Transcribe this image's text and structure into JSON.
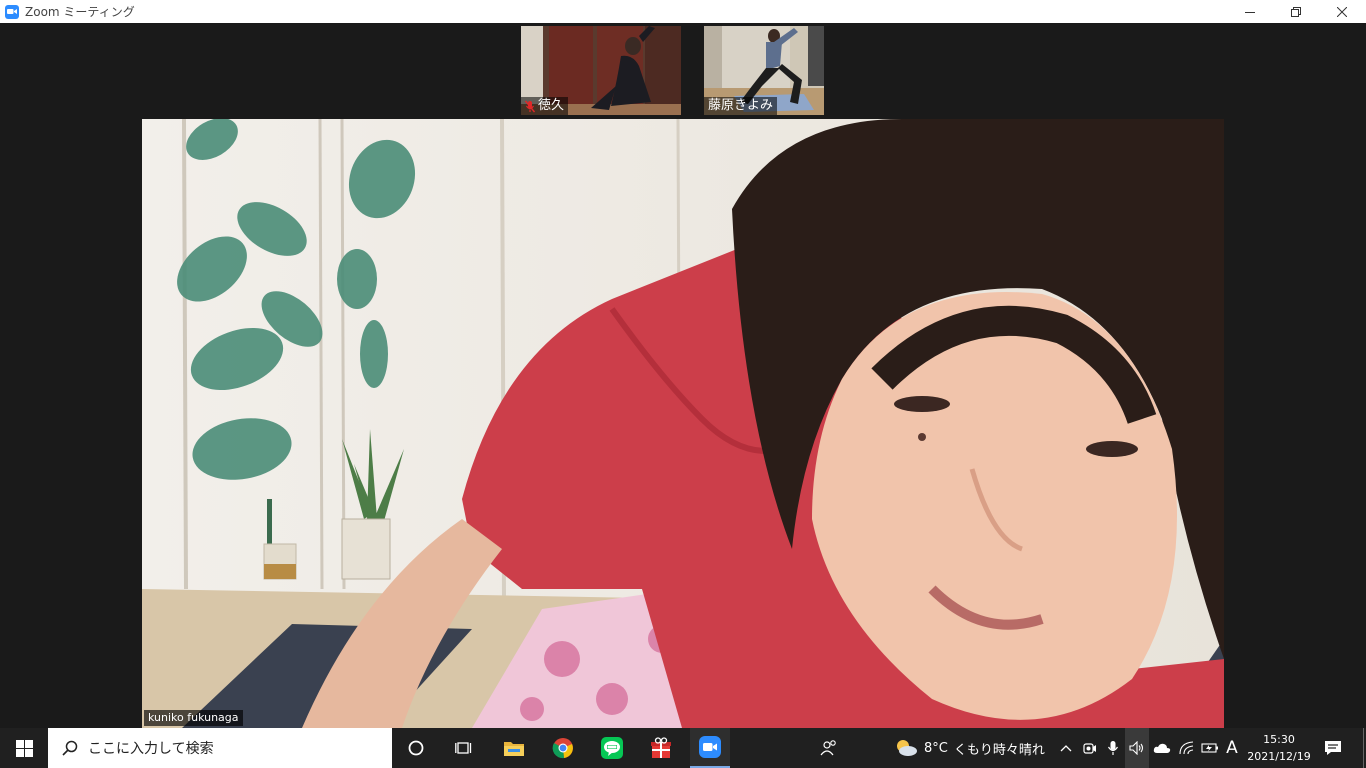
{
  "window": {
    "title": "Zoom ミーティング",
    "minimize_label": "—",
    "restore_label": "❐",
    "close_label": "✕"
  },
  "participants": {
    "thumbnails": [
      {
        "name": "徳久",
        "muted": true
      },
      {
        "name": "藤原きよみ",
        "muted": false
      }
    ],
    "speaker": {
      "name": "kuniko fukunaga"
    }
  },
  "taskbar": {
    "search_placeholder": "ここに入力して検索",
    "pinned_apps": [
      "cortana-icon",
      "task-view-icon",
      "file-explorer-icon",
      "chrome-icon",
      "line-icon",
      "gift-app-icon",
      "zoom-icon"
    ],
    "weather": {
      "temp": "8°C",
      "condition": "くもり時々晴れ"
    },
    "ime": "A",
    "clock": {
      "time": "15:30",
      "date": "2021/12/19"
    }
  },
  "colors": {
    "accent": "#2d8cff",
    "taskbar_bg": "#202020",
    "stage_bg": "#1a1a1a",
    "muted_red": "#e02828"
  }
}
